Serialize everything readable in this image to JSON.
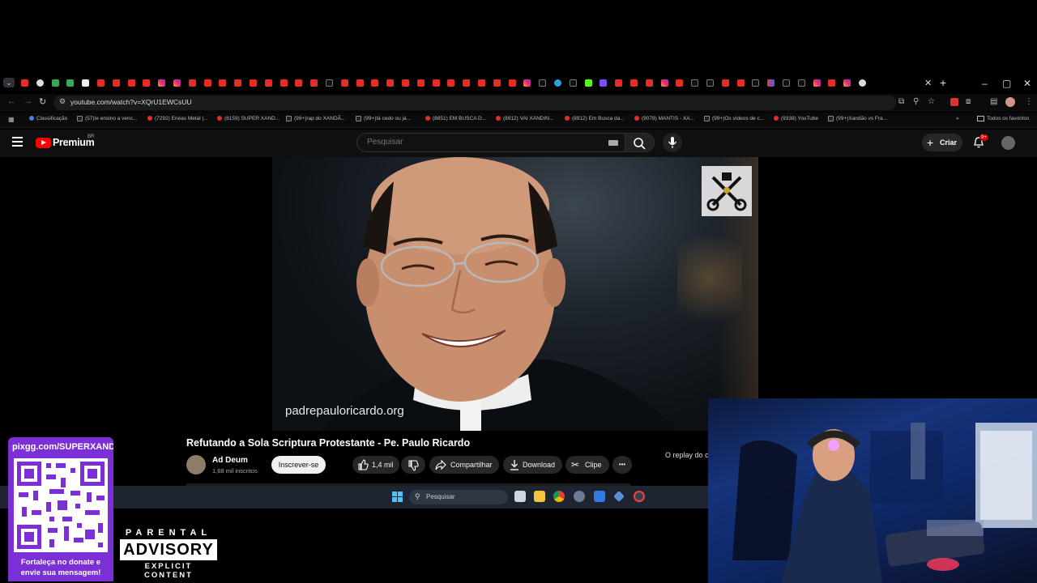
{
  "browser": {
    "tab_favicons": [
      "youtube",
      "chrome",
      "green",
      "green",
      "white",
      "youtube",
      "youtube",
      "youtube",
      "youtube",
      "instagram",
      "instagram",
      "youtube",
      "youtube",
      "youtube",
      "youtube",
      "youtube",
      "youtube",
      "youtube",
      "youtube",
      "youtube",
      "tiktok",
      "youtube",
      "youtube",
      "youtube",
      "youtube",
      "youtube",
      "youtube",
      "youtube",
      "youtube",
      "youtube",
      "youtube",
      "youtube",
      "youtube",
      "instagram",
      "tiktok",
      "telegram",
      "tiktok",
      "kick",
      "twitch",
      "youtube",
      "youtube",
      "youtube",
      "instagram",
      "youtube",
      "tiktok",
      "tiktok",
      "youtube",
      "youtube",
      "tiktok",
      "redblue",
      "tiktok",
      "tiktok",
      "instagram",
      "youtube",
      "instagram",
      "chrome"
    ],
    "new_tab_label": "+",
    "close_tab_label": "✕",
    "window_controls": [
      "–",
      "▢",
      "✕"
    ],
    "url": "youtube.com/watch?v=XQrU1EWCsUU",
    "bookmarks": [
      {
        "label": "Classificação",
        "icon": "class"
      },
      {
        "label": "(57)Ie ensino a venc...",
        "icon": "tiktok"
      },
      {
        "label": "(7292) Enéas Metal |...",
        "icon": "youtube"
      },
      {
        "label": "(8159) SUPER XAND...",
        "icon": "youtube"
      },
      {
        "label": "(99+)rap do XANDÃ...",
        "icon": "tiktok"
      },
      {
        "label": "(99+)tá cedo ou já...",
        "icon": "tiktok"
      },
      {
        "label": "(8851) EM BUSCA D...",
        "icon": "youtube"
      },
      {
        "label": "(8912) VAI XANDIN...",
        "icon": "youtube"
      },
      {
        "label": "(8912) Em Busca da...",
        "icon": "youtube"
      },
      {
        "label": "(9078) MANTIS - XA...",
        "icon": "youtube"
      },
      {
        "label": "(99+)Os vídeos de c...",
        "icon": "tiktok"
      },
      {
        "label": "(9338) YouTube",
        "icon": "youtube"
      },
      {
        "label": "(99+)Xandão vs Fra...",
        "icon": "tiktok"
      }
    ],
    "all_bookmarks_label": "Todos os favoritos"
  },
  "youtube": {
    "logo_text": "Premium",
    "region": "BR",
    "search_placeholder": "Pesquisar",
    "create_label": "Criar",
    "notification_count": "9+",
    "video": {
      "overlay_site": "padrepauloricardo.org",
      "title": "Refutando a Sola Scriptura Protestante - Pe. Paulo Ricardo",
      "channel_name": "Ad Deum",
      "subscribers": "1,68 mil inscritos",
      "subscribe_label": "Inscrever-se",
      "likes": "1,4 mil",
      "share_label": "Compartilhar",
      "download_label": "Download",
      "clip_label": "Clipe",
      "more_label": "•••",
      "chat_replay": "O replay do ch"
    }
  },
  "taskbar": {
    "search_placeholder": "Pesquisar"
  },
  "overlays": {
    "qr_url": "pixgg.com/SUPERXANDAO",
    "qr_caption_1": "Fortaleça no donate e",
    "qr_caption_2": "envie sua mensagem!",
    "parental_line1": "PARENTAL",
    "parental_line2": "ADVISORY",
    "parental_line3": "EXPLICIT CONTENT"
  },
  "colors": {
    "youtube_red": "#ff0000",
    "qr_panel": "#7b2fd6",
    "windows_accent": "#4cc2ff"
  }
}
